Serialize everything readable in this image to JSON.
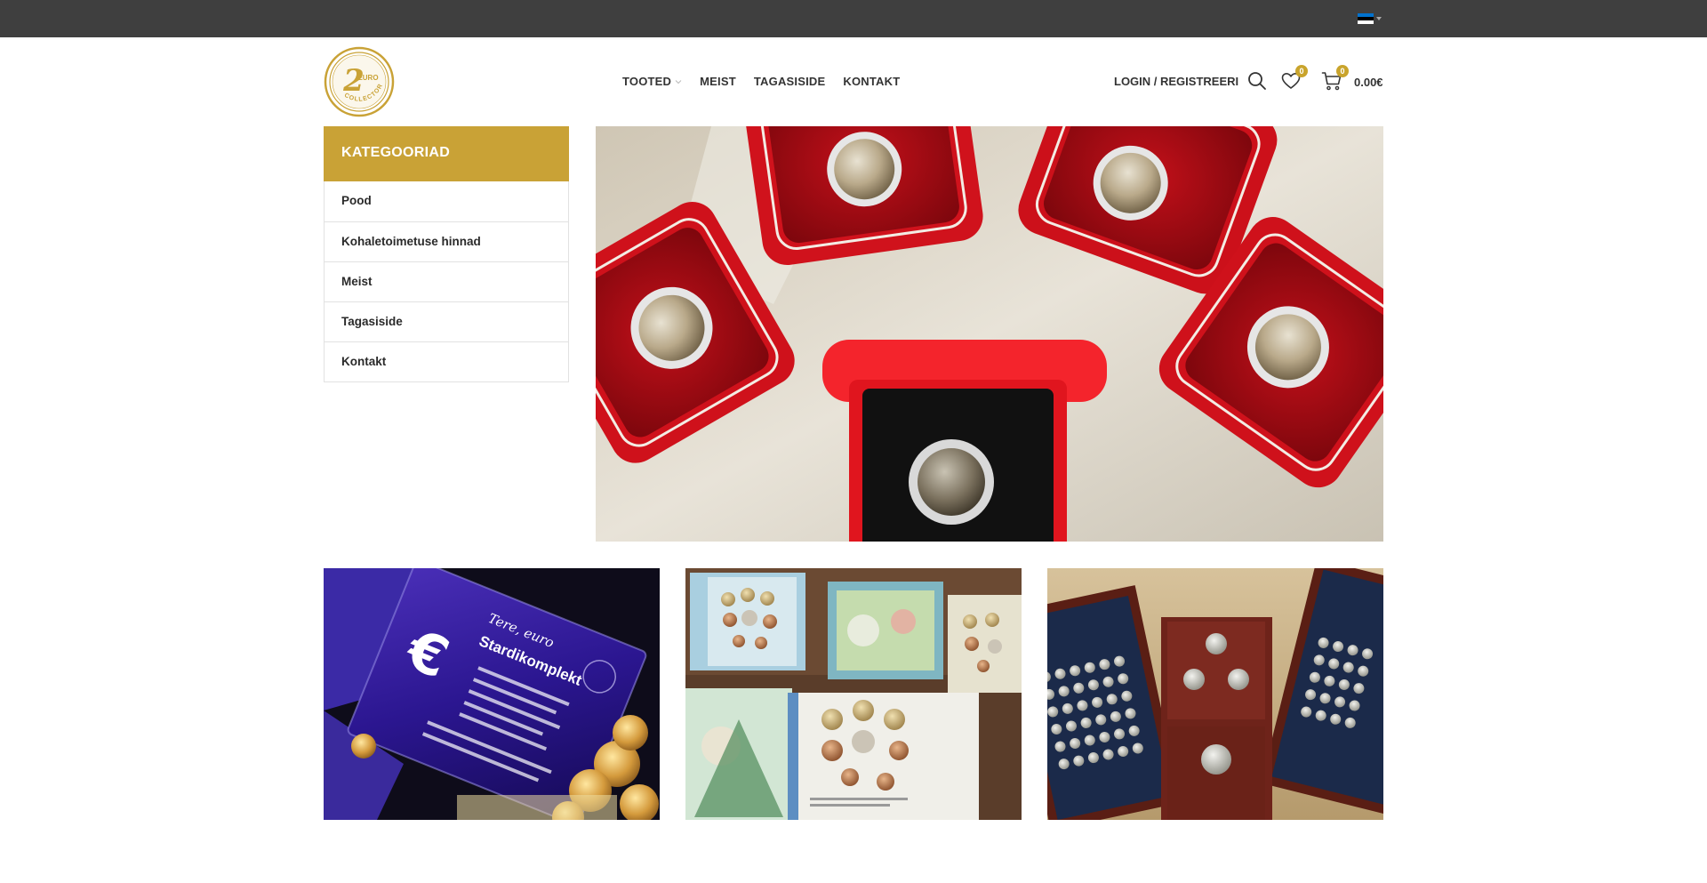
{
  "topbar": {
    "language_flag": {
      "icon": "estonia-flag-icon",
      "colors": [
        "#0072CE",
        "#000000",
        "#FFFFFF"
      ]
    }
  },
  "logo": {
    "numeral": "2",
    "text_top": "EURO",
    "text_bottom": "COLLECTOR",
    "color": "#C9A236"
  },
  "nav": {
    "items": [
      {
        "label": "TOOTED",
        "has_dropdown": true
      },
      {
        "label": "MEIST"
      },
      {
        "label": "TAGASISIDE"
      },
      {
        "label": "KONTAKT"
      }
    ]
  },
  "header_right": {
    "login_label": "LOGIN / REGISTREERI",
    "search_icon": "search-icon",
    "wishlist": {
      "icon": "heart-icon",
      "count": "0"
    },
    "cart": {
      "icon": "cart-icon",
      "count": "0",
      "total": "0.00€"
    }
  },
  "sidebar": {
    "title": "KATEGOORIAD",
    "items": [
      {
        "label": "Pood"
      },
      {
        "label": "Kohaletoimetuse hinnad"
      },
      {
        "label": "Meist"
      },
      {
        "label": "Tagasiside"
      },
      {
        "label": "Kontakt"
      }
    ]
  },
  "images": {
    "hero": {
      "accent": "#C8151D"
    },
    "tiles": [
      {
        "texts": [
          "Tere, euro",
          "Stardikomplekt"
        ]
      },
      {
        "texts": []
      },
      {
        "texts": []
      }
    ]
  },
  "colors": {
    "topbar": "#3F3F3F",
    "accent": "#C9A236",
    "badge": "#C9A42C"
  }
}
